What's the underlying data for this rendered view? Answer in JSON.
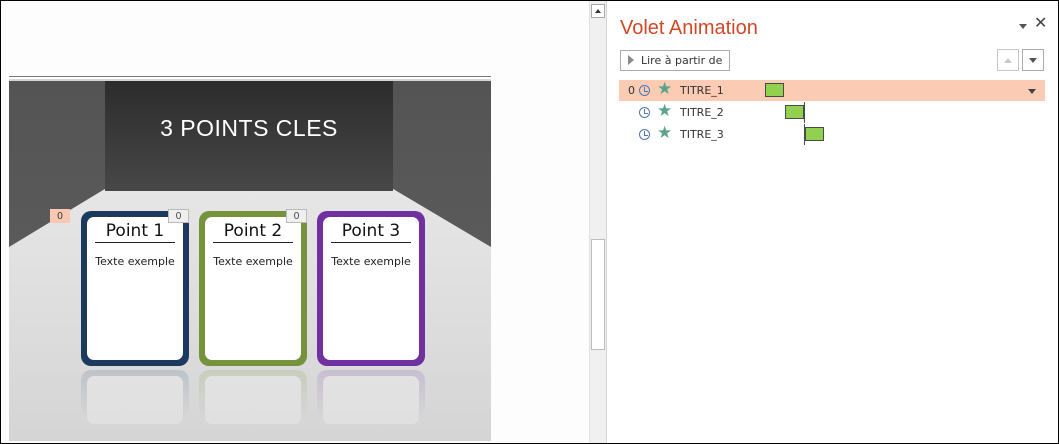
{
  "slide": {
    "title": "3 POINTS CLES",
    "main_anim_tag": "0",
    "cards": [
      {
        "heading": "Point 1",
        "text": "Texte exemple",
        "tag": "0",
        "color": "#1b3a5e"
      },
      {
        "heading": "Point 2",
        "text": "Texte exemple",
        "tag": "0",
        "color": "#76923c"
      },
      {
        "heading": "Point 3",
        "text": "Texte exemple",
        "color": "#7030a0"
      }
    ]
  },
  "pane": {
    "title": "Volet Animation",
    "title_color": "#d24726",
    "play_button": "Lire à partir de",
    "menu_icon": "chevron-down-icon",
    "close_icon": "close-icon",
    "items": [
      {
        "number": "0",
        "label": "TITRE_1",
        "selected": true
      },
      {
        "number": "",
        "label": "TITRE_2",
        "selected": false
      },
      {
        "number": "",
        "label": "TITRE_3",
        "selected": false
      }
    ],
    "selected_row_color": "#fccbb3",
    "timing_bar_color": "#92d050"
  }
}
